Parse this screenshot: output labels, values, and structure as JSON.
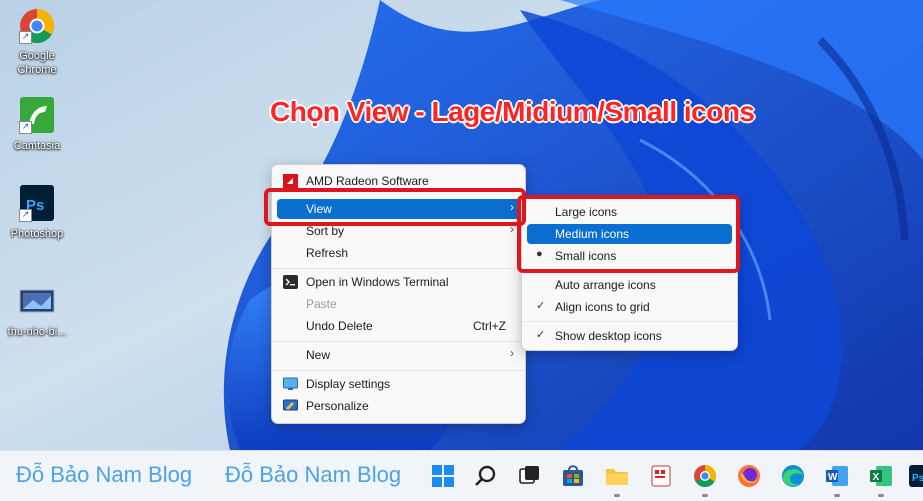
{
  "desktop": {
    "icons": [
      {
        "label": "Google Chrome"
      },
      {
        "label": "Camtasia"
      },
      {
        "label": "Photoshop"
      },
      {
        "label": "thu-nho-bi..."
      }
    ]
  },
  "annotation": {
    "title": "Chọn View - Lage/Midium/Small icons",
    "color": "#ff2424"
  },
  "context_menu": {
    "amd": "AMD Radeon Software",
    "view": "View",
    "sort_by": "Sort by",
    "refresh": "Refresh",
    "terminal": "Open in Windows Terminal",
    "paste": "Paste",
    "undo_delete": "Undo Delete",
    "undo_shortcut": "Ctrl+Z",
    "new": "New",
    "display_settings": "Display settings",
    "personalize": "Personalize",
    "highlight_color": "#0a6fd0"
  },
  "view_submenu": {
    "large": "Large icons",
    "medium": "Medium icons",
    "small": "Small icons",
    "auto_arrange": "Auto arrange icons",
    "align_grid": "Align icons to grid",
    "show_desktop": "Show desktop icons",
    "selected": "Small icons"
  },
  "taskbar": {
    "watermark_1": "Đỗ Bảo Nam Blog",
    "watermark_2": "Đỗ Bảo Nam Blog",
    "apps": [
      "windows-start-icon",
      "search-icon",
      "task-view-icon",
      "store-icon",
      "file-explorer-icon",
      "snip-icon",
      "chrome-icon",
      "firefox-icon",
      "edge-icon",
      "word-icon",
      "excel-icon",
      "photoshop-icon"
    ]
  }
}
